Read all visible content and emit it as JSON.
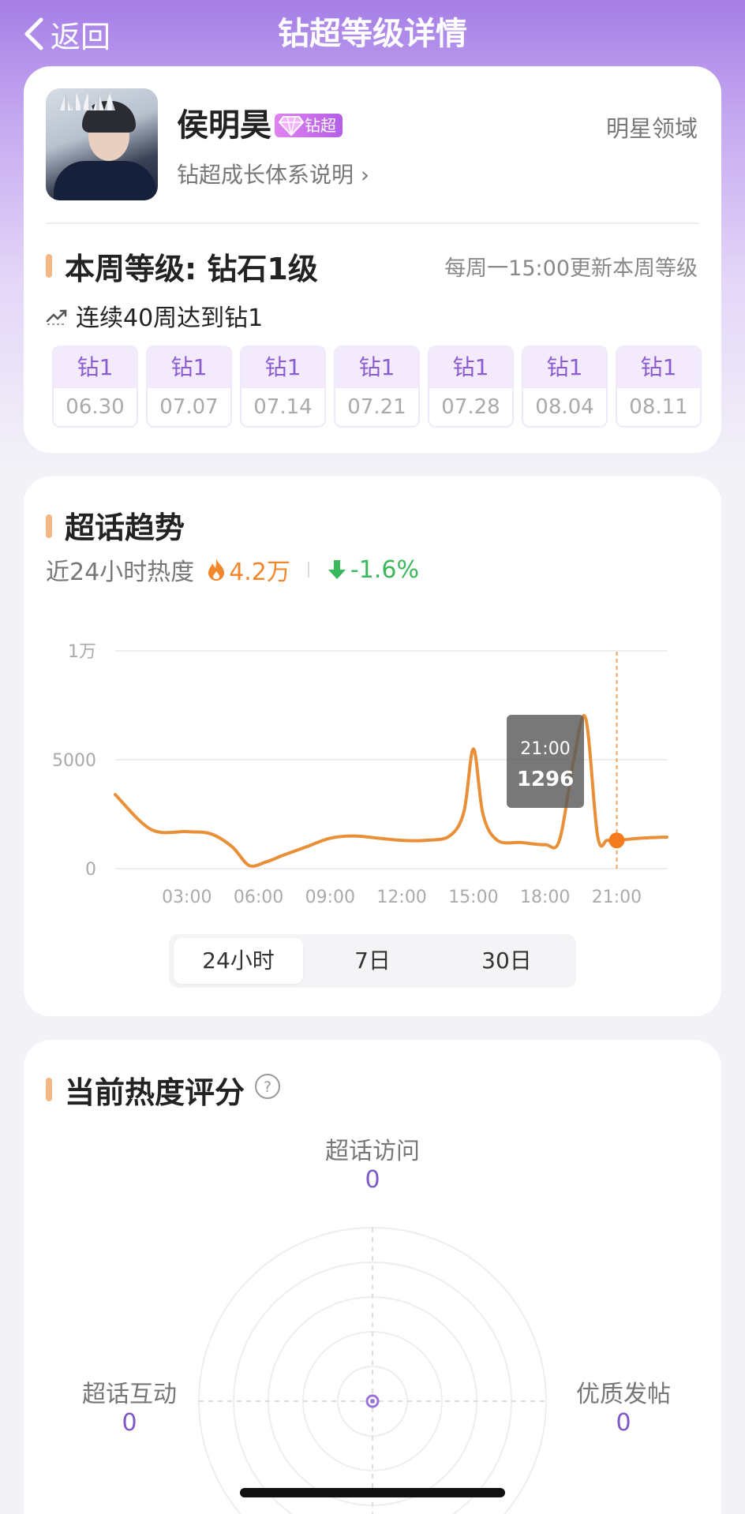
{
  "nav": {
    "back_label": "返回",
    "title": "钻超等级详情"
  },
  "profile": {
    "name": "侯明昊",
    "badge_label": "钻超",
    "growth_link": "钻超成长体系说明 ›",
    "domain": "明星领域"
  },
  "level": {
    "title": "本周等级: 钻石1级",
    "update_note": "每周一15:00更新本周等级",
    "streak": "连续40周达到钻1",
    "weeks": [
      {
        "level": "钻1",
        "date": "06.30"
      },
      {
        "level": "钻1",
        "date": "07.07"
      },
      {
        "level": "钻1",
        "date": "07.14"
      },
      {
        "level": "钻1",
        "date": "07.21"
      },
      {
        "level": "钻1",
        "date": "07.28"
      },
      {
        "level": "钻1",
        "date": "08.04"
      },
      {
        "level": "钻1",
        "date": "08.11"
      }
    ]
  },
  "trend": {
    "title": "超话趋势",
    "heat_label": "近24小时热度",
    "heat_value": "4.2万",
    "heat_change": "-1.6%",
    "tabs": [
      "24小时",
      "7日",
      "30日"
    ],
    "active_tab": 0
  },
  "chart_data": {
    "type": "line",
    "x_ticks": [
      "03:00",
      "06:00",
      "09:00",
      "12:00",
      "15:00",
      "18:00",
      "21:00"
    ],
    "y_ticks": [
      "1万",
      "5000",
      "0"
    ],
    "ylim": [
      0,
      10000
    ],
    "x": [
      0,
      1.5,
      3,
      4,
      4.9,
      5.6,
      6.3,
      7,
      8,
      9,
      10,
      11,
      12,
      13,
      14,
      14.6,
      15,
      15.4,
      16,
      17,
      18,
      18.6,
      19.2,
      19.7,
      20.2,
      20.6,
      21,
      22,
      23.1
    ],
    "values": [
      3400,
      1800,
      1700,
      1600,
      1000,
      150,
      300,
      600,
      1000,
      1400,
      1500,
      1400,
      1300,
      1300,
      1500,
      2600,
      5500,
      2500,
      1300,
      1200,
      1100,
      1300,
      5000,
      6900,
      1500,
      1300,
      1296,
      1400,
      1450
    ],
    "tooltip": {
      "time": "21:00",
      "value": "1296"
    },
    "highlight_x": 21,
    "colors": {
      "line": "#e88f38",
      "marker": "#f47c1f",
      "guide": "#f0a45c"
    }
  },
  "score": {
    "title": "当前热度评分",
    "axes": [
      {
        "label": "超话访问",
        "value": "0"
      },
      {
        "label": "超话互动",
        "value": "0"
      },
      {
        "label": "优质发帖",
        "value": "0"
      }
    ]
  }
}
